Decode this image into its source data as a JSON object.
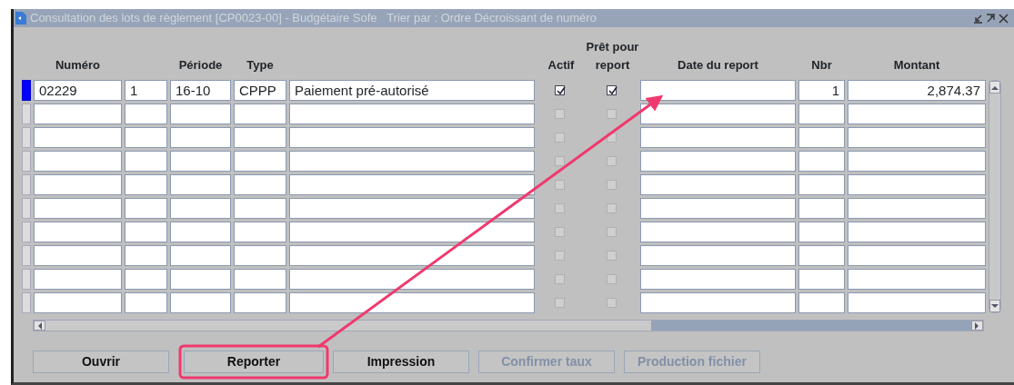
{
  "window": {
    "title": "Consultation des lots de règlement [CP0023-00] - Budgétaire Sofe   Trier par : Ordre Décroissant de numéro"
  },
  "table": {
    "headers": [
      "Numéro",
      "Période",
      "Type",
      "Actif",
      "Prêt pour report",
      "Date du report",
      "Nbr",
      "Montant"
    ],
    "rows": [
      {
        "selected": true,
        "numero": "02229",
        "column_2": "1",
        "periode": "16-10",
        "type": "CPPP",
        "description": "Paiement pré-autorisé",
        "actif": true,
        "pret": true,
        "nbr": "1",
        "montant": "2,874.37"
      },
      {
        "selected": false,
        "actif": false,
        "pret": false
      },
      {
        "selected": false,
        "actif": false,
        "pret": false
      },
      {
        "selected": false,
        "actif": false,
        "pret": false
      },
      {
        "selected": false,
        "actif": false,
        "pret": false
      },
      {
        "selected": false,
        "actif": false,
        "pret": false
      },
      {
        "selected": false,
        "actif": false,
        "pret": false
      },
      {
        "selected": false,
        "actif": false,
        "pret": false
      },
      {
        "selected": false,
        "actif": false,
        "pret": false
      },
      {
        "selected": false,
        "actif": false,
        "pret": false
      }
    ]
  },
  "buttons": [
    {
      "label": "Ouvrir",
      "disabled": false,
      "highlighted": false
    },
    {
      "label": "Reporter",
      "disabled": false,
      "highlighted": true
    },
    {
      "label": "Impression",
      "disabled": false,
      "highlighted": false
    },
    {
      "label": "Confirmer taux",
      "disabled": true,
      "highlighted": false
    },
    {
      "label": "Production fichier",
      "disabled": true,
      "highlighted": false
    }
  ]
}
